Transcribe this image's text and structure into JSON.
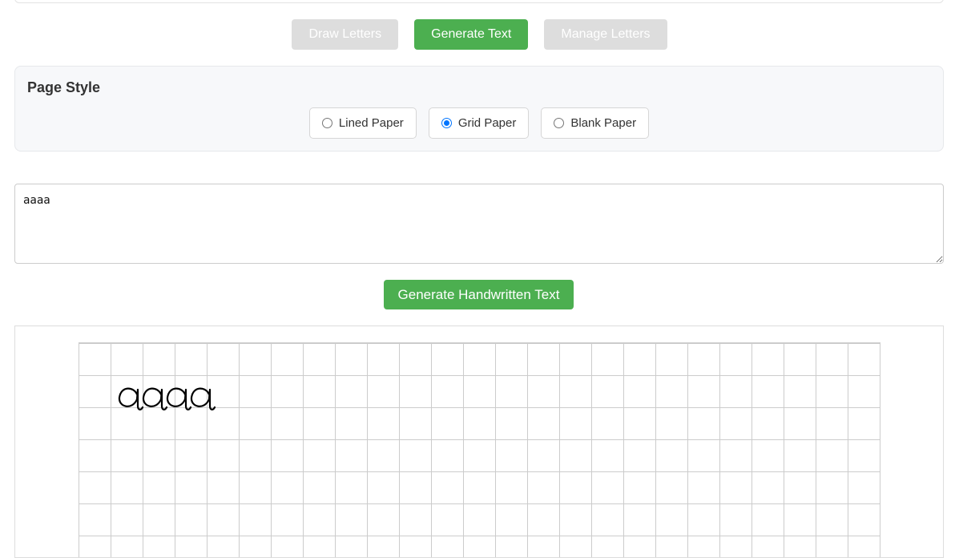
{
  "modes": {
    "draw_label": "Draw Letters",
    "generate_label": "Generate Text",
    "manage_label": "Manage Letters",
    "active": "generate"
  },
  "page_style": {
    "title": "Page Style",
    "options": [
      {
        "label": "Lined Paper",
        "checked": false
      },
      {
        "label": "Grid Paper",
        "checked": true
      },
      {
        "label": "Blank Paper",
        "checked": false
      }
    ]
  },
  "input": {
    "value": "aaaa"
  },
  "generate": {
    "label": "Generate Handwritten Text"
  },
  "output": {
    "rendered_text": "aaaa",
    "paper": "grid"
  },
  "colors": {
    "accent": "#4caf50",
    "inactive_button": "#dddddd",
    "radio_checked": "#0075ff",
    "grid_line": "#cccccc"
  }
}
